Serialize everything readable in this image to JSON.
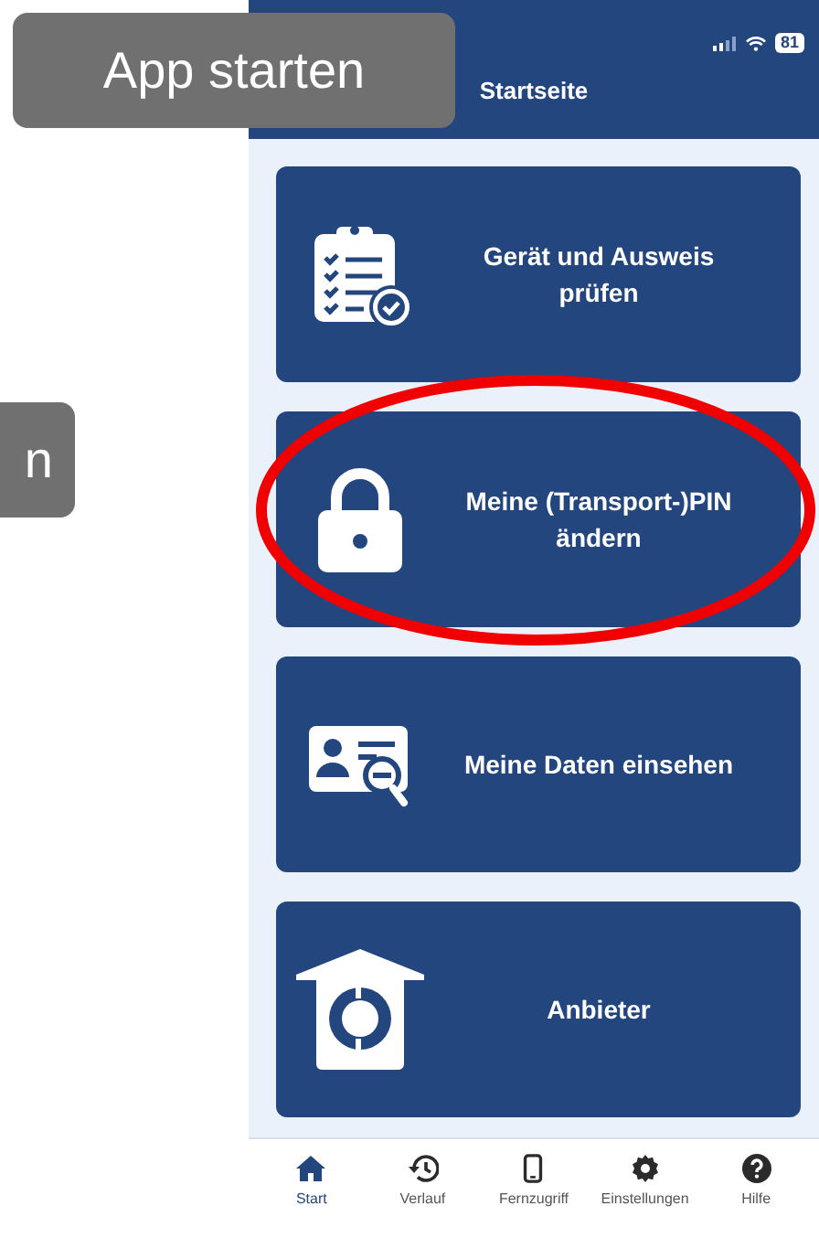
{
  "callouts": [
    {
      "text": "App starten",
      "kind": "top"
    },
    {
      "text": "n",
      "kind": "side"
    }
  ],
  "status_bar": {
    "battery": "81"
  },
  "header": {
    "title": "Startseite"
  },
  "cards": [
    {
      "kind": "checklist",
      "label": "Gerät und Ausweis prüfen",
      "highlighted": false
    },
    {
      "kind": "lock",
      "label": "Meine (Transport-)PIN ändern",
      "highlighted": true
    },
    {
      "kind": "idcard",
      "label": "Meine Daten einsehen",
      "highlighted": false
    },
    {
      "kind": "provider",
      "label": "Anbieter",
      "highlighted": false
    }
  ],
  "tab_bar": [
    {
      "kind": "home",
      "label": "Start",
      "selected": true
    },
    {
      "kind": "history",
      "label": "Verlauf",
      "selected": false
    },
    {
      "kind": "phone",
      "label": "Fernzugriff",
      "selected": false
    },
    {
      "kind": "gear",
      "label": "Einstellungen",
      "selected": false
    },
    {
      "kind": "help",
      "label": "Hilfe",
      "selected": false
    }
  ]
}
